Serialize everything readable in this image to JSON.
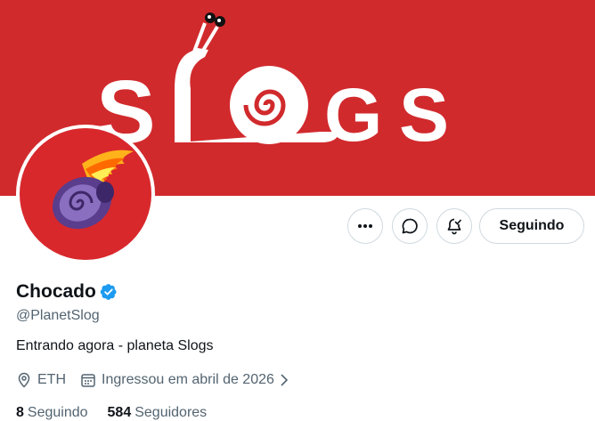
{
  "banner": {
    "logo_text": "Slogs",
    "color": "#d12a2d"
  },
  "avatar": {
    "description": "flaming purple snail shell"
  },
  "actions": {
    "more_icon": "more-horizontal-icon",
    "message_icon": "message-bubble-icon",
    "notify_icon": "bell-check-icon",
    "follow_label": "Seguindo"
  },
  "profile": {
    "name": "Chocado",
    "verified": true,
    "handle": "@PlanetSlog",
    "bio": "Entrando agora - planeta Slogs",
    "location": "ETH",
    "joined": "Ingressou em abril de 2026"
  },
  "stats": {
    "following_count": "8",
    "following_label": "Seguindo",
    "followers_count": "584",
    "followers_label": "Seguidores"
  },
  "colors": {
    "verified_blue": "#1d9bf0",
    "text_secondary": "#536471",
    "border": "#cfd9de"
  }
}
